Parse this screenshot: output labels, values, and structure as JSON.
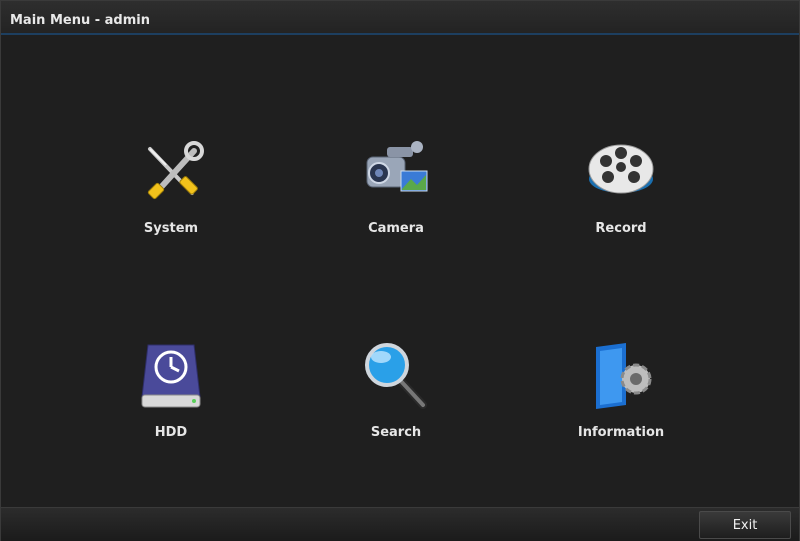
{
  "window": {
    "title": "Main Menu - admin"
  },
  "menu": {
    "items": [
      {
        "label": "System",
        "icon": "tools-icon"
      },
      {
        "label": "Camera",
        "icon": "camcorder-icon"
      },
      {
        "label": "Record",
        "icon": "film-reel-icon"
      },
      {
        "label": "HDD",
        "icon": "hard-drive-icon"
      },
      {
        "label": "Search",
        "icon": "magnifier-icon"
      },
      {
        "label": "Information",
        "icon": "info-folder-gear-icon"
      }
    ]
  },
  "footer": {
    "exit_label": "Exit"
  },
  "colors": {
    "background": "#1f1f1f",
    "title_accent": "#1d3f60",
    "text": "#e6e6e6"
  }
}
